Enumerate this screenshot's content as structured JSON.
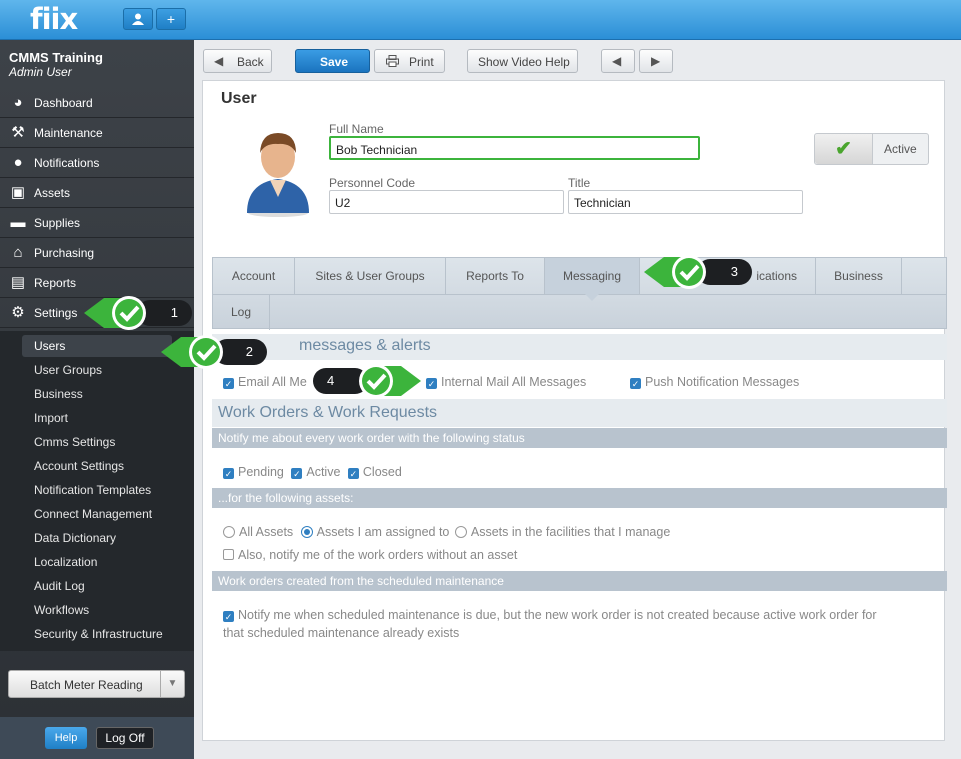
{
  "app": {
    "logo": "fiix",
    "top_user_icon": "user-icon",
    "top_add_label": "+"
  },
  "org": {
    "name": "CMMS Training",
    "role": "Admin User"
  },
  "nav": [
    {
      "label": "Dashboard",
      "icon": "palette-icon",
      "glyph": "◕"
    },
    {
      "label": "Maintenance",
      "icon": "tools-icon",
      "glyph": "⚒"
    },
    {
      "label": "Notifications",
      "icon": "speech-bubble-icon",
      "glyph": "●"
    },
    {
      "label": "Assets",
      "icon": "box-icon",
      "glyph": "▣"
    },
    {
      "label": "Supplies",
      "icon": "truck-icon",
      "glyph": "▬"
    },
    {
      "label": "Purchasing",
      "icon": "cart-icon",
      "glyph": "⌂"
    },
    {
      "label": "Reports",
      "icon": "chart-icon",
      "glyph": "▤"
    },
    {
      "label": "Settings",
      "icon": "gear-icon",
      "glyph": "⚙"
    }
  ],
  "subnav": [
    "Users",
    "User Groups",
    "Business",
    "Import",
    "Cmms Settings",
    "Account Settings",
    "Notification Templates",
    "Connect Management",
    "Data Dictionary",
    "Localization",
    "Audit Log",
    "Workflows",
    "Security & Infrastructure"
  ],
  "sidebar_footer": {
    "batch_label": "Batch Meter Reading",
    "help_label": "Help",
    "logoff_label": "Log Off"
  },
  "toolbar": {
    "back_label": "Back",
    "save_label": "Save",
    "print_label": "Print",
    "video_help_label": "Show Video Help"
  },
  "user": {
    "title": "User",
    "full_name_label": "Full Name",
    "full_name_value": "Bob Technician",
    "personnel_code_label": "Personnel Code",
    "personnel_code_value": "U2",
    "title_label": "Title",
    "title_value": "Technician",
    "active_label": "Active"
  },
  "tabs": [
    "Account",
    "Sites & User Groups",
    "Reports To",
    "Messaging",
    "Certifications",
    "Business",
    "Log"
  ],
  "tab_visible_fragment": "ications",
  "messaging": {
    "section1_title": "messages & alerts",
    "email_all": "Email All Messages",
    "email_all_visible": "Email All Me",
    "internal_mail": "Internal Mail All Messages",
    "push": "Push Notification Messages",
    "section2_title": "Work Orders & Work Requests",
    "bar1": "Notify me about every work order with the following status",
    "status_pending": "Pending",
    "status_active": "Active",
    "status_closed": "Closed",
    "bar2": "...for the following assets:",
    "assets_all": "All Assets",
    "assets_assigned": "Assets I am assigned to",
    "assets_facilities": "Assets in the facilities that I manage",
    "no_asset": "Also, notify me of the work orders without an asset",
    "bar3": "Work orders created from the scheduled maintenance",
    "sched_line1": "Notify me when scheduled maintenance is due, but the new work order is not created because active work order for",
    "sched_line2": "that scheduled maintenance already exists"
  },
  "callouts": [
    "1",
    "2",
    "3",
    "4"
  ],
  "colors": {
    "accent": "#2b8fd6",
    "callout_green": "#3cb43c",
    "sidebar": "#2c3035"
  }
}
